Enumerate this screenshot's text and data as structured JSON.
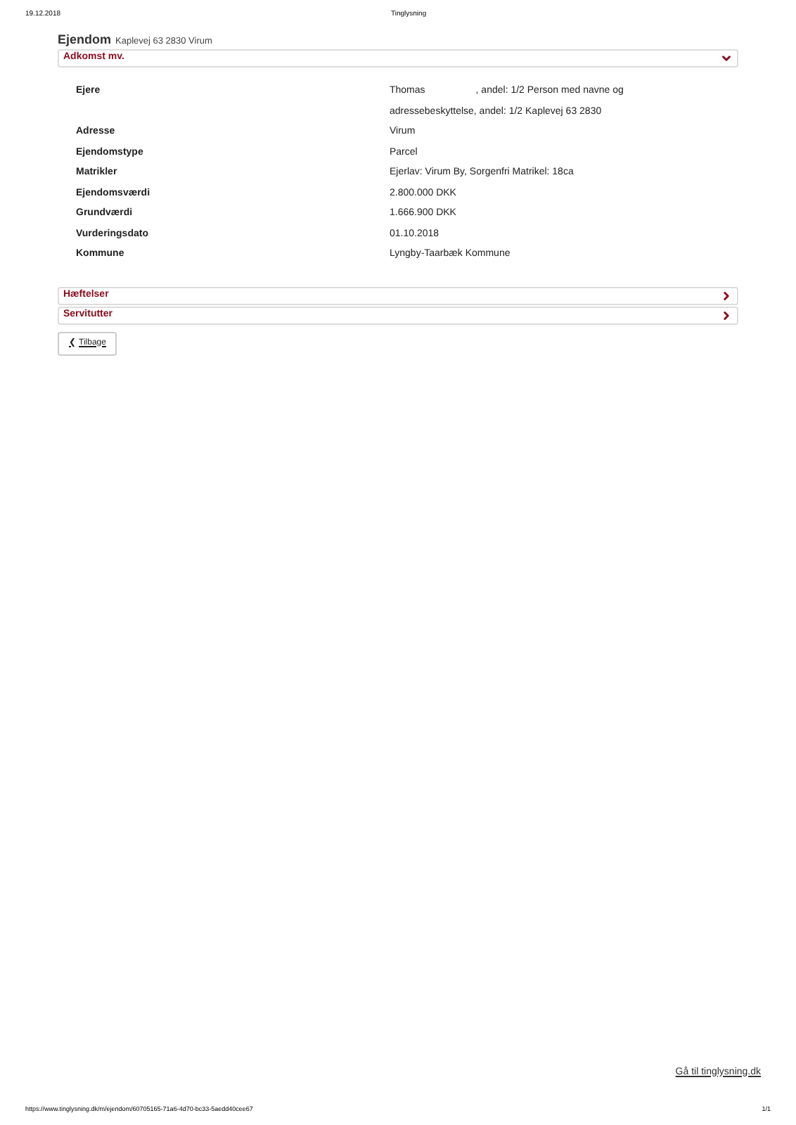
{
  "print_header": {
    "date": "19.12.2018",
    "title": "Tinglysning"
  },
  "heading": {
    "title": "Ejendom",
    "address": "Kaplevej 63 2830 Virum"
  },
  "sections": [
    {
      "title": "Adkomst mv.",
      "expanded": true,
      "rows": [
        {
          "label": "Ejere",
          "lines": [
            [
              "Thomas",
              ", andel: 1/2 Person med navne og"
            ],
            [
              "adressebeskyttelse, andel: 1/2 Kaplevej 63 2830"
            ]
          ]
        },
        {
          "label": "Adresse",
          "lines": [
            [
              "Virum"
            ]
          ]
        },
        {
          "label": "Ejendomstype",
          "lines": [
            [
              "Parcel"
            ]
          ]
        },
        {
          "label": "Matrikler",
          "lines": [
            [
              "Ejerlav: Virum By, Sorgenfri Matrikel: 18ca"
            ]
          ]
        },
        {
          "label": "Ejendomsværdi",
          "lines": [
            [
              "2.800.000 DKK"
            ]
          ]
        },
        {
          "label": "Grundværdi",
          "lines": [
            [
              "1.666.900 DKK"
            ]
          ]
        },
        {
          "label": "Vurderingsdato",
          "lines": [
            [
              "01.10.2018"
            ]
          ]
        },
        {
          "label": "Kommune",
          "lines": [
            [
              "Lyngby-Taarbæk Kommune"
            ]
          ]
        }
      ]
    },
    {
      "title": "Hæftelser",
      "expanded": false
    },
    {
      "title": "Servitutter",
      "expanded": false
    }
  ],
  "back_button": {
    "arrow": "❮",
    "label": "Tilbage"
  },
  "footer_link": "Gå til tinglysning.dk",
  "print_footer": {
    "url": "https://www.tinglysning.dk/m/ejendom/60705165-71a6-4d70-bc33-5aedd40cee67",
    "page": "1/1"
  }
}
